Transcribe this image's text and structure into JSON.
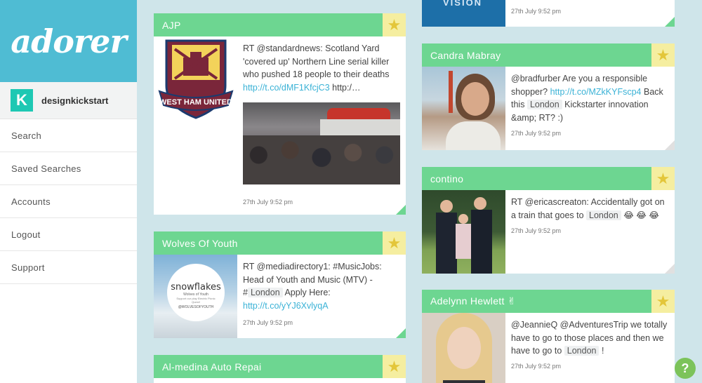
{
  "app": {
    "logo": "adorer"
  },
  "account": {
    "badge": "K",
    "name": "designkickstart"
  },
  "nav": [
    "Search",
    "Saved Searches",
    "Accounts",
    "Logout",
    "Support"
  ],
  "cards": {
    "top_right": {
      "timestamp": "27th July 9:52 pm",
      "partial_image_text": "VISION"
    },
    "ajp": {
      "title": "AJP",
      "text_pre": "RT @standardnews: Scotland Yard 'covered up' Northern Line serial killer who pushed 18 people to their deaths ",
      "link": "http://t.co/dMF1KfcjC3",
      "text_post": " http:/…",
      "crest_text": "WEST HAM UNITED",
      "timestamp": "27th July 9:52 pm"
    },
    "wolves": {
      "title": "Wolves Of Youth",
      "text_pre": "RT @mediadirectory1: #MusicJobs: Head of Youth and Music (MTV) - #",
      "tag": "London",
      "text_mid": " Apply Here: ",
      "link": "http://t.co/yYJ6XvlyqA",
      "thumb_title": "snowflakes",
      "thumb_sub": "Wolves of Youth",
      "thumb_tagline": "Support our play Electric Picnic Quest!",
      "thumb_handle": "@WOLVESOFYOUTH",
      "timestamp": "27th July 9:52 pm"
    },
    "almedina": {
      "title": "Al-medina Auto Repai"
    },
    "candra": {
      "title": "Candra Mabray",
      "text_pre": "@bradfurber Are you a responsible shopper? ",
      "link": "http://t.co/MZkKYFscp4",
      "text_mid": " Back this ",
      "tag": "London",
      "text_post": " Kickstarter innovation &amp; RT? :)",
      "timestamp": "27th July 9:52 pm"
    },
    "contino": {
      "title": "contino",
      "text_pre": "RT @ericascreaton: Accidentally got on a train that goes to ",
      "tag": "London",
      "text_post": " 😂 😂 😂",
      "timestamp": "27th July 9:52 pm"
    },
    "adelynn": {
      "title": "Adelynn Hewlett ✌",
      "text_pre": "@JeannieQ @AdventuresTrip we totally have to go to those places and then we have to go to ",
      "tag": "London",
      "text_post": " !",
      "timestamp": "27th July 9:52 pm"
    }
  },
  "help": "?"
}
